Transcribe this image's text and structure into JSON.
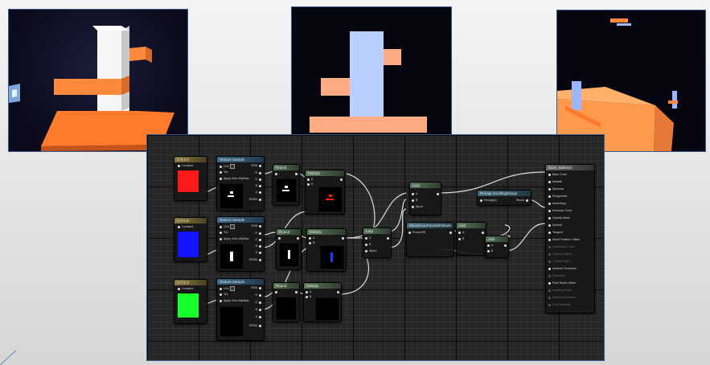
{
  "colors": {
    "red": "#ff1a1a",
    "blue": "#1414ff",
    "green": "#17ff2b",
    "orange": "#ff8a3c",
    "pale_blue": "#b8cfff"
  },
  "viewports": [
    {
      "name": "viewport-3d-scene",
      "desc": "orange platform with white tower"
    },
    {
      "name": "viewport-flat-silhouette",
      "desc": "glowing blue/orange silhouette"
    },
    {
      "name": "viewport-angled-scene",
      "desc": "orange block with blue emissive"
    }
  ],
  "params": [
    {
      "title": "V R 0 0",
      "label": "Constant",
      "color": "#ff1a1a"
    },
    {
      "title": "V 0 0 B",
      "label": "Constant",
      "color": "#1414ff"
    },
    {
      "title": "V 0 G 0",
      "label": "Constant",
      "color": "#17ff2b"
    }
  ],
  "tex_samples": [
    {
      "title": "Texture Sample",
      "uvs": "UVs",
      "tex": "Tex",
      "apply": "Apply View MipBias",
      "outs": [
        "RGB",
        "R",
        "G",
        "B",
        "A",
        "RGBA"
      ]
    },
    {
      "title": "Texture Sample",
      "uvs": "UVs",
      "tex": "Tex",
      "apply": "Apply View MipBias",
      "outs": [
        "RGB",
        "R",
        "G",
        "B",
        "A",
        "RGBA"
      ]
    },
    {
      "title": "Texture Sample",
      "uvs": "UVs",
      "tex": "Tex",
      "apply": "Apply View MipBias",
      "outs": [
        "RGB",
        "R",
        "G",
        "B",
        "A",
        "RGBA"
      ]
    }
  ],
  "rounds": [
    "Round",
    "Round",
    "Round"
  ],
  "multiplies": [
    "Multiply",
    "Multiply",
    "Multiply"
  ],
  "pin_a": "A",
  "pin_b": "B",
  "pin_alpha": "Alpha",
  "lerps": [
    "Lerp",
    "Lerp"
  ],
  "blend_fn": {
    "title": "BlendScanPassWithMode",
    "input": "PowerOfE"
  },
  "add_nodes": [
    "Add",
    "Add"
  ],
  "remap": {
    "title": "Remap ScrollingRange",
    "out": "Remap(x)",
    "pin": "Result"
  },
  "result": {
    "title": "Scan_Material",
    "pins": [
      {
        "label": "Base Color",
        "active": true
      },
      {
        "label": "Metallic",
        "active": true
      },
      {
        "label": "Specular",
        "active": true
      },
      {
        "label": "Roughness",
        "active": true
      },
      {
        "label": "Anisotropy",
        "active": true
      },
      {
        "label": "Emissive Color",
        "active": true
      },
      {
        "label": "Opacity Mask",
        "active": true
      },
      {
        "label": "Normal",
        "active": true
      },
      {
        "label": "Tangent",
        "active": true
      },
      {
        "label": "World Position Offset",
        "active": true
      },
      {
        "label": "Subsurface Color",
        "active": false
      },
      {
        "label": "Custom Data 0",
        "active": false
      },
      {
        "label": "Custom Data 1",
        "active": false
      },
      {
        "label": "Ambient Occlusion",
        "active": true
      },
      {
        "label": "Refraction",
        "active": false
      },
      {
        "label": "Pixel Depth Offset",
        "active": true
      },
      {
        "label": "Shading Model",
        "active": false
      },
      {
        "label": "Material Attributes",
        "active": false
      },
      {
        "label": "Front Material",
        "active": false
      }
    ]
  }
}
